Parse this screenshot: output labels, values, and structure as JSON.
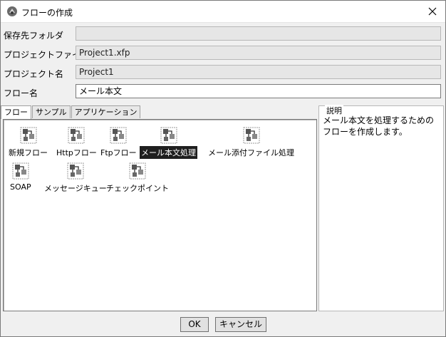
{
  "window": {
    "title": "フローの作成"
  },
  "form": {
    "save_folder": {
      "label": "保存先フォルダ",
      "value": ""
    },
    "project_file": {
      "label": "プロジェクトファイル名",
      "value": "Project1.xfp"
    },
    "project_name": {
      "label": "プロジェクト名",
      "value": "Project1"
    },
    "flow_name": {
      "label": "フロー名",
      "value": "メール本文"
    }
  },
  "tabs": [
    {
      "label": "フロー",
      "active": true
    },
    {
      "label": "サンプル",
      "active": false
    },
    {
      "label": "アプリケーション",
      "active": false
    }
  ],
  "flow_items": [
    {
      "label": "新規フロー"
    },
    {
      "label": "Httpフロー"
    },
    {
      "label": "Ftpフロー"
    },
    {
      "label": "メール本文処理",
      "selected": true
    },
    {
      "label": "メール添付ファイル処理"
    },
    {
      "label": "SOAP"
    },
    {
      "label": "メッセージキュー"
    },
    {
      "label": "チェックポイント"
    }
  ],
  "description": {
    "title": "説明",
    "text": "メール本文を処理するためのフローを作成します。"
  },
  "buttons": {
    "ok": "OK",
    "cancel": "キャンセル"
  }
}
